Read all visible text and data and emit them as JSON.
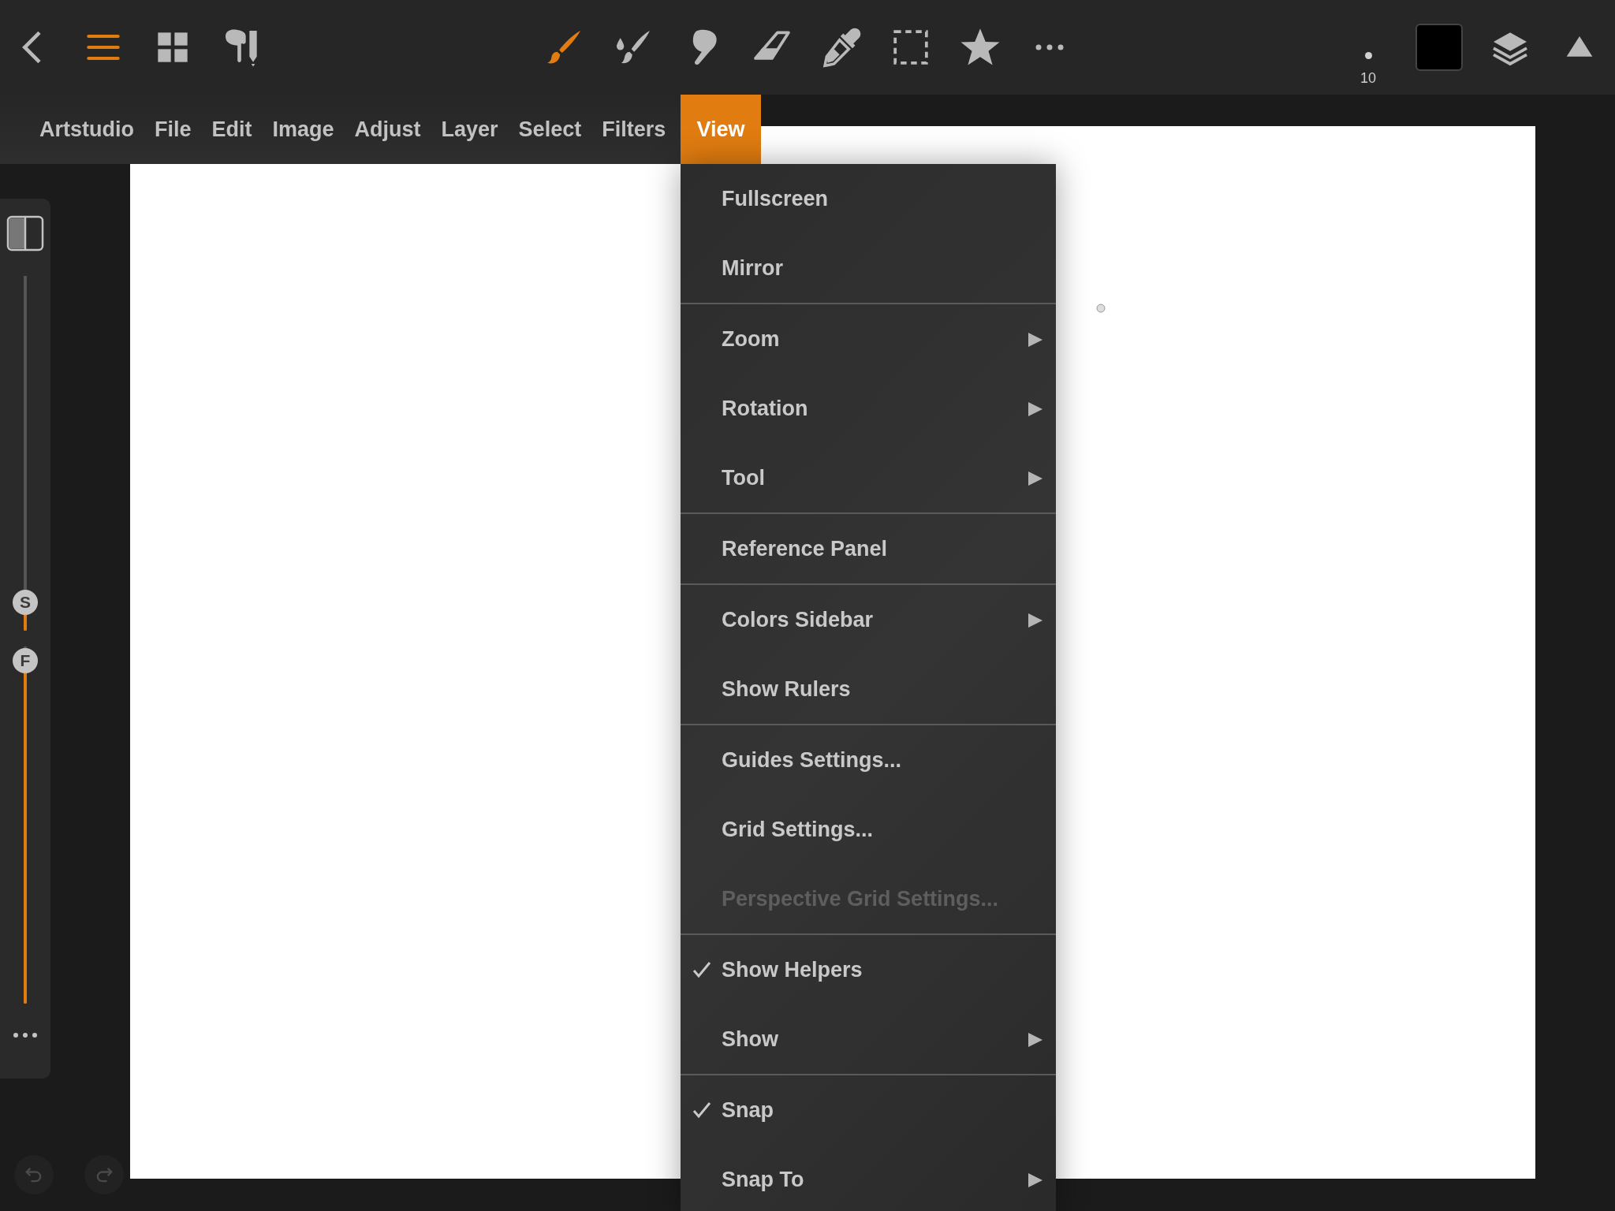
{
  "toolbar": {
    "menu_button": {
      "selected": true
    },
    "tools": [
      {
        "selected": true
      },
      {
        "selected": false
      },
      {
        "selected": false
      },
      {
        "selected": false
      },
      {
        "selected": false
      },
      {
        "selected": false
      },
      {
        "selected": false
      }
    ],
    "brush_size": "10",
    "color": "#000000"
  },
  "menu_bar": [
    {
      "label": "Artstudio",
      "selected": false
    },
    {
      "label": "File",
      "selected": false
    },
    {
      "label": "Edit",
      "selected": false
    },
    {
      "label": "Image",
      "selected": false
    },
    {
      "label": "Adjust",
      "selected": false
    },
    {
      "label": "Layer",
      "selected": false
    },
    {
      "label": "Select",
      "selected": false
    },
    {
      "label": "Filters",
      "selected": false
    },
    {
      "label": "View",
      "selected": true
    }
  ],
  "view_menu": {
    "groups": [
      [
        {
          "label": "Fullscreen",
          "submenu": false,
          "checked": false,
          "disabled": false
        },
        {
          "label": "Mirror",
          "submenu": false,
          "checked": false,
          "disabled": false
        }
      ],
      [
        {
          "label": "Zoom",
          "submenu": true,
          "checked": false,
          "disabled": false
        },
        {
          "label": "Rotation",
          "submenu": true,
          "checked": false,
          "disabled": false
        },
        {
          "label": "Tool",
          "submenu": true,
          "checked": false,
          "disabled": false
        }
      ],
      [
        {
          "label": "Reference Panel",
          "submenu": false,
          "checked": false,
          "disabled": false
        }
      ],
      [
        {
          "label": "Colors Sidebar",
          "submenu": true,
          "checked": false,
          "disabled": false
        },
        {
          "label": "Show Rulers",
          "submenu": false,
          "checked": false,
          "disabled": false
        }
      ],
      [
        {
          "label": "Guides Settings...",
          "submenu": false,
          "checked": false,
          "disabled": false
        },
        {
          "label": "Grid Settings...",
          "submenu": false,
          "checked": false,
          "disabled": false
        },
        {
          "label": "Perspective Grid Settings...",
          "submenu": false,
          "checked": false,
          "disabled": true
        }
      ],
      [
        {
          "label": "Show Helpers",
          "submenu": false,
          "checked": true,
          "disabled": false
        },
        {
          "label": "Show",
          "submenu": true,
          "checked": false,
          "disabled": false
        }
      ],
      [
        {
          "label": "Snap",
          "submenu": false,
          "checked": true,
          "disabled": false
        },
        {
          "label": "Snap To",
          "submenu": true,
          "checked": false,
          "disabled": false
        }
      ]
    ]
  },
  "side_panel": {
    "sliders": [
      {
        "label": "S",
        "level": 0.08
      },
      {
        "label": "F",
        "level": 0.96
      }
    ]
  }
}
